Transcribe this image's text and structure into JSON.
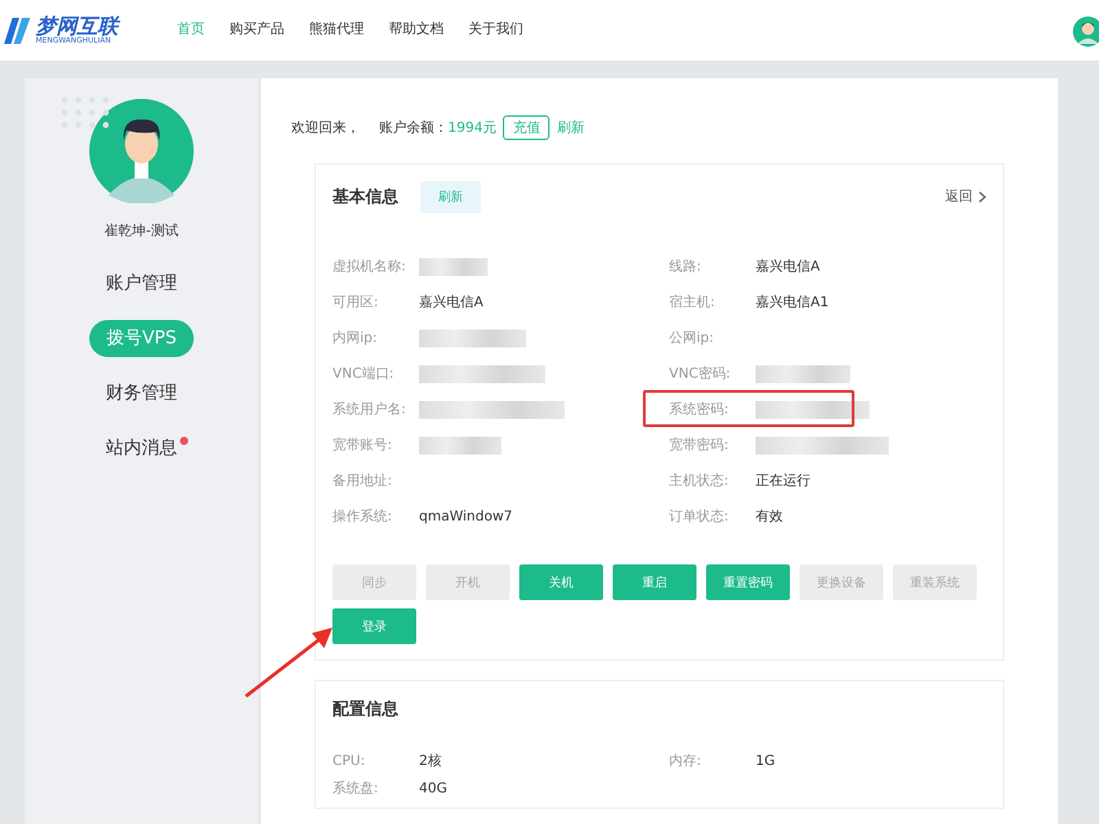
{
  "header": {
    "logo": {
      "name": "梦网互联",
      "subtitle": "MENGWANGHULIAN"
    },
    "nav": [
      {
        "label": "首页",
        "selected": true
      },
      {
        "label": "购买产品",
        "selected": false
      },
      {
        "label": "熊猫代理",
        "selected": false
      },
      {
        "label": "帮助文档",
        "selected": false
      },
      {
        "label": "关于我们",
        "selected": false
      }
    ]
  },
  "sidebar": {
    "user_name": "崔乾坤-测试",
    "items": [
      {
        "label": "账户管理",
        "selected": false,
        "badge": false
      },
      {
        "label": "拨号VPS",
        "selected": true,
        "badge": false
      },
      {
        "label": "财务管理",
        "selected": false,
        "badge": false
      },
      {
        "label": "站内消息",
        "selected": false,
        "badge": true
      }
    ]
  },
  "welcome": {
    "greeting": "欢迎回来，",
    "balance_label": "账户余额：",
    "balance": "1994元",
    "recharge": "充值",
    "refresh": "刷新"
  },
  "basic_info": {
    "title": "基本信息",
    "refresh": "刷新",
    "back": "返回",
    "fields": [
      {
        "label": "虚拟机名称:",
        "blurred": true,
        "highlighted": false
      },
      {
        "label": "线路:",
        "value": "嘉兴电信A",
        "blurred": false,
        "highlighted": false
      },
      {
        "label": "可用区:",
        "value": "嘉兴电信A",
        "blurred": false,
        "highlighted": false
      },
      {
        "label": "宿主机:",
        "value": "嘉兴电信A1",
        "blurred": false,
        "highlighted": false
      },
      {
        "label": "内网ip:",
        "blurred": true,
        "highlighted": false
      },
      {
        "label": "公网ip:",
        "blurred": false,
        "highlighted": false
      },
      {
        "label": "VNC端口:",
        "blurred": true,
        "highlighted": false
      },
      {
        "label": "VNC密码:",
        "blurred": true,
        "highlighted": false
      },
      {
        "label": "系统用户名:",
        "blurred": true,
        "highlighted": false
      },
      {
        "label": "系统密码:",
        "blurred": true,
        "highlighted": true
      },
      {
        "label": "宽带账号:",
        "blurred": true,
        "highlighted": false
      },
      {
        "label": "宽带密码:",
        "blurred": true,
        "highlighted": false
      },
      {
        "label": "备用地址:",
        "blurred": false,
        "highlighted": false
      },
      {
        "label": "主机状态:",
        "value": "正在运行",
        "blurred": false,
        "highlighted": false
      },
      {
        "label": "操作系统:",
        "value": "qmaWindow7",
        "blurred": false,
        "highlighted": false
      },
      {
        "label": "订单状态:",
        "value": "有效",
        "blurred": false,
        "highlighted": false
      }
    ],
    "buttons": [
      {
        "label": "同步",
        "disabled": true
      },
      {
        "label": "开机",
        "disabled": true
      },
      {
        "label": "关机",
        "disabled": false
      },
      {
        "label": "重启",
        "disabled": false
      },
      {
        "label": "重置密码",
        "disabled": false
      },
      {
        "label": "更换设备",
        "disabled": true
      },
      {
        "label": "重装系统",
        "disabled": true
      }
    ],
    "login": {
      "label": "登录",
      "annotated": true
    }
  },
  "config_info": {
    "title": "配置信息",
    "fields": [
      {
        "label": "CPU:",
        "value": "2核"
      },
      {
        "label": "内存:",
        "value": "1G"
      },
      {
        "label": "系统盘:",
        "value": "40G"
      }
    ]
  }
}
